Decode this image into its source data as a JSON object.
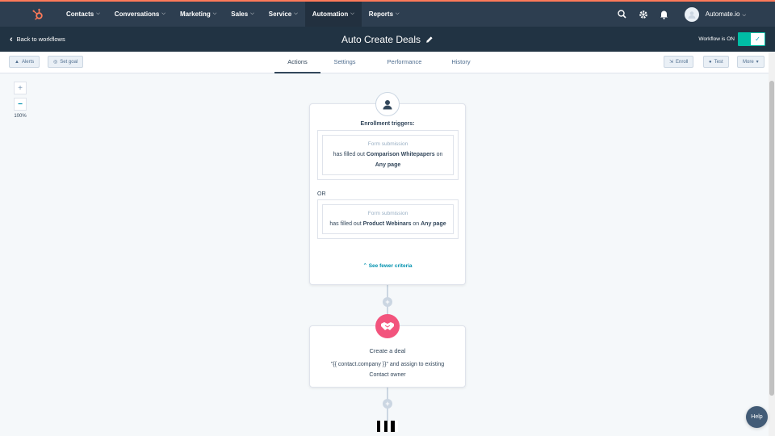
{
  "colors": {
    "nav_bg": "#2d3e50",
    "accent_teal": "#00bda5",
    "link": "#0091ae",
    "deal_icon": "#f2547d",
    "brand_orange": "#ff7a59"
  },
  "topnav": {
    "logo_icon": "hubspot-sprocket-icon",
    "items": [
      {
        "label": "Contacts"
      },
      {
        "label": "Conversations"
      },
      {
        "label": "Marketing"
      },
      {
        "label": "Sales"
      },
      {
        "label": "Service"
      },
      {
        "label": "Automation",
        "active": true
      },
      {
        "label": "Reports"
      }
    ],
    "account": "Automate.io"
  },
  "titlebar": {
    "back_label": "Back to workflows",
    "title": "Auto Create Deals",
    "toggle_label": "Workflow is ON",
    "toggle_on": true
  },
  "toolbar": {
    "alerts": "Alerts",
    "set_goal": "Set goal",
    "tabs": [
      "Actions",
      "Settings",
      "Performance",
      "History"
    ],
    "active_tab": "Actions",
    "enroll": "Enroll",
    "test": "Test",
    "more": "More"
  },
  "zoom": {
    "plus": "+",
    "minus": "−",
    "level": "100%"
  },
  "trigger_card": {
    "heading": "Enrollment triggers:",
    "criteria": [
      {
        "type": "Form submission",
        "prefix": "has filled out",
        "form": "Comparison Whitepapers",
        "on": "on",
        "page": "Any page"
      },
      {
        "type": "Form submission",
        "prefix": "has filled out",
        "form": "Product Webinars",
        "on": "on",
        "page": "Any page"
      }
    ],
    "or_label": "OR",
    "fewer_label": "See fewer criteria"
  },
  "action_card": {
    "title": "Create a deal",
    "desc_line1": "\"{{ contact.company }}\" and assign to existing",
    "desc_line2": "Contact owner"
  },
  "help_label": "Help"
}
